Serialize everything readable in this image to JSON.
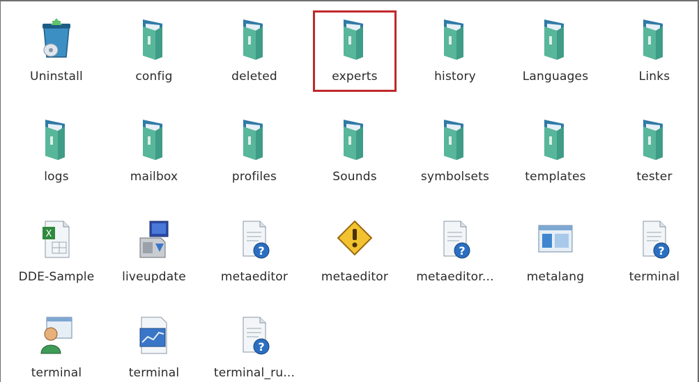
{
  "colors": {
    "folder_front": "#58b69a",
    "folder_back": "#2f7aa6",
    "paper": "#e8f0f7",
    "highlight_border": "#c0282c"
  },
  "items": [
    {
      "label": "Uninstall",
      "icon": "uninstall-bin-icon"
    },
    {
      "label": "config",
      "icon": "folder-icon"
    },
    {
      "label": "deleted",
      "icon": "folder-icon"
    },
    {
      "label": "experts",
      "icon": "folder-icon"
    },
    {
      "label": "history",
      "icon": "folder-icon"
    },
    {
      "label": "Languages",
      "icon": "folder-icon"
    },
    {
      "label": "Links",
      "icon": "folder-icon"
    },
    {
      "label": "logs",
      "icon": "folder-icon"
    },
    {
      "label": "mailbox",
      "icon": "folder-icon"
    },
    {
      "label": "profiles",
      "icon": "folder-icon"
    },
    {
      "label": "Sounds",
      "icon": "folder-icon"
    },
    {
      "label": "symbolsets",
      "icon": "folder-icon"
    },
    {
      "label": "templates",
      "icon": "folder-icon"
    },
    {
      "label": "tester",
      "icon": "folder-icon"
    },
    {
      "label": "DDE-Sample",
      "icon": "excel-file-icon"
    },
    {
      "label": "liveupdate",
      "icon": "installer-icon"
    },
    {
      "label": "metaeditor",
      "icon": "help-file-icon"
    },
    {
      "label": "metaeditor",
      "icon": "warning-icon"
    },
    {
      "label": "metaeditor...",
      "icon": "help-file-icon"
    },
    {
      "label": "metalang",
      "icon": "window-app-icon"
    },
    {
      "label": "terminal",
      "icon": "help-file-icon"
    },
    {
      "label": "terminal",
      "icon": "user-app-icon"
    },
    {
      "label": "terminal",
      "icon": "chart-app-icon"
    },
    {
      "label": "terminal_ru...",
      "icon": "help-file-icon"
    }
  ],
  "selected": {
    "label": "experts"
  }
}
